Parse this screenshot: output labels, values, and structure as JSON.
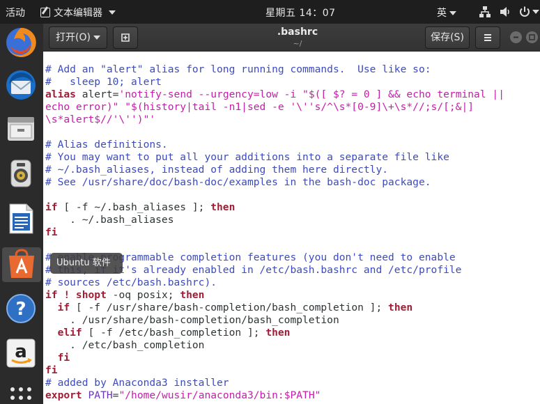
{
  "topbar": {
    "activities": "活动",
    "app_name": "文本编辑器",
    "clock": "星期五 14：07",
    "ime": "英"
  },
  "dock": {
    "tooltip": "Ubuntu 软件",
    "items": [
      "firefox-icon",
      "thunderbird-icon",
      "files-icon",
      "rhythmbox-icon",
      "libreoffice-writer-icon",
      "ubuntu-software-icon",
      "help-icon",
      "amazon-icon",
      "show-apps-icon"
    ]
  },
  "header": {
    "open_label": "打开(O)",
    "file_name": ".bashrc",
    "file_path": "~/",
    "save_label": "保存(S)"
  },
  "colors": {
    "comment": "#3c4bbd",
    "keyword": "#a11d35",
    "string": "#c31ea8",
    "variable": "#6a35b5",
    "topbar": "#1e1e1e",
    "dock": "#2b2b2b",
    "close_button": "#e95420"
  },
  "code_lines": [
    [
      [
        "c",
        "# Add an \"alert\" alias for long running commands.  Use like so:"
      ]
    ],
    [
      [
        "c",
        "#   sleep 10; alert"
      ]
    ],
    [
      [
        "k",
        "alias"
      ],
      [
        "p",
        " alert="
      ],
      [
        "s",
        "'notify-send --urgency=low -i \"$([ $? = 0 ] && echo terminal ||"
      ]
    ],
    [
      [
        "s",
        "echo error)\" \"$(history|tail -n1|sed -e '\\''s/^\\s*[0-9]\\+\\s*//;s/[;&|]"
      ]
    ],
    [
      [
        "s",
        "\\s*alert$//'\\'')\"'"
      ]
    ],
    [
      [
        "p",
        ""
      ]
    ],
    [
      [
        "c",
        "# Alias definitions."
      ]
    ],
    [
      [
        "c",
        "# You may want to put all your additions into a separate file like"
      ]
    ],
    [
      [
        "c",
        "# ~/.bash_aliases, instead of adding them here directly."
      ]
    ],
    [
      [
        "c",
        "# See /usr/share/doc/bash-doc/examples in the bash-doc package."
      ]
    ],
    [
      [
        "p",
        ""
      ]
    ],
    [
      [
        "k",
        "if"
      ],
      [
        "p",
        " [ -f ~/.bash_aliases ]; "
      ],
      [
        "k",
        "then"
      ]
    ],
    [
      [
        "p",
        "    . ~/.bash_aliases"
      ]
    ],
    [
      [
        "k",
        "fi"
      ]
    ],
    [
      [
        "p",
        ""
      ]
    ],
    [
      [
        "c",
        "# enable programmable completion features (you don't need to enable"
      ]
    ],
    [
      [
        "c",
        "# this, if it's already enabled in /etc/bash.bashrc and /etc/profile"
      ]
    ],
    [
      [
        "c",
        "# sources /etc/bash.bashrc)."
      ]
    ],
    [
      [
        "k",
        "if ! shopt"
      ],
      [
        "p",
        " -oq posix; "
      ],
      [
        "k",
        "then"
      ]
    ],
    [
      [
        "p",
        "  "
      ],
      [
        "k",
        "if"
      ],
      [
        "p",
        " [ -f /usr/share/bash-completion/bash_completion ]; "
      ],
      [
        "k",
        "then"
      ]
    ],
    [
      [
        "p",
        "    . /usr/share/bash-completion/bash_completion"
      ]
    ],
    [
      [
        "p",
        "  "
      ],
      [
        "k",
        "elif"
      ],
      [
        "p",
        " [ -f /etc/bash_completion ]; "
      ],
      [
        "k",
        "then"
      ]
    ],
    [
      [
        "p",
        "    . /etc/bash_completion"
      ]
    ],
    [
      [
        "p",
        "  "
      ],
      [
        "k",
        "fi"
      ]
    ],
    [
      [
        "k",
        "fi"
      ]
    ],
    [
      [
        "c",
        "# added by Anaconda3 installer"
      ]
    ],
    [
      [
        "k",
        "export"
      ],
      [
        "p",
        " "
      ],
      [
        "v",
        "PATH"
      ],
      [
        "p",
        "="
      ],
      [
        "s",
        "\"/home/wusir/anaconda3/bin:$PATH\""
      ]
    ]
  ]
}
